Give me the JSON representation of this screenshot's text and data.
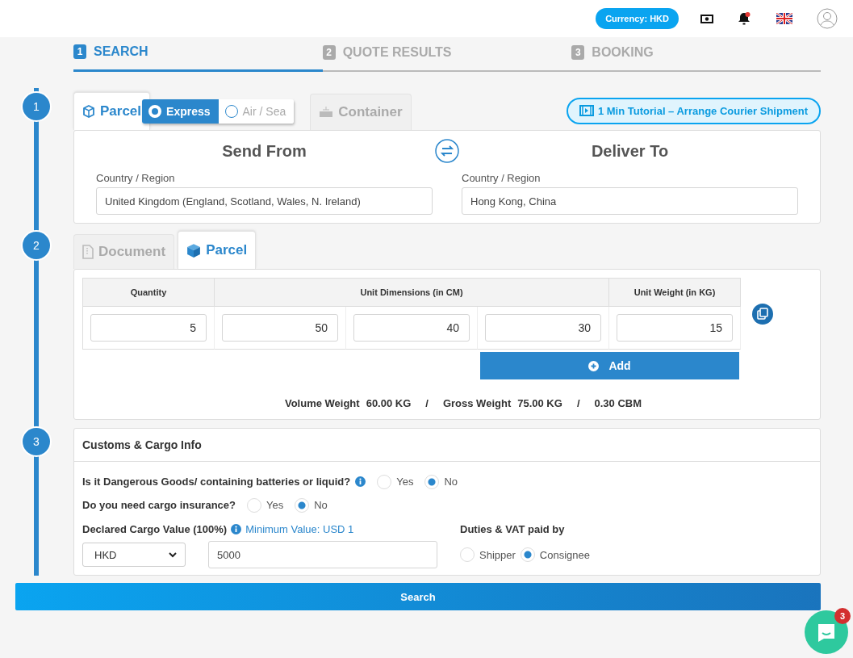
{
  "header": {
    "currency": "Currency: HKD"
  },
  "steps": [
    {
      "number": "1",
      "label": "SEARCH",
      "selected": true
    },
    {
      "number": "2",
      "label": "QUOTE RESULTS",
      "selected": false
    },
    {
      "number": "3",
      "label": "BOOKING",
      "selected": false
    }
  ],
  "section_numbers": [
    "1",
    "2",
    "3"
  ],
  "mode_tabs": [
    {
      "label": "Parcel",
      "selected": true,
      "kind": "parcel"
    },
    {
      "label": "Container",
      "selected": false,
      "kind": "container"
    }
  ],
  "service_options": [
    {
      "label": "Express",
      "selected": true
    },
    {
      "label": "Air / Sea",
      "selected": false
    }
  ],
  "tutorial_button": "1 Min Tutorial – Arrange Courier Shipment",
  "route": {
    "from_title": "Send From",
    "to_title": "Deliver To",
    "from_label": "Country / Region",
    "from_value": "United Kingdom (England, Scotland, Wales, N. Ireland)",
    "to_label": "Country / Region",
    "to_value": "Hong Kong, China"
  },
  "item_tabs": [
    {
      "label": "Document",
      "selected": false,
      "kind": "document"
    },
    {
      "label": "Parcel",
      "selected": true,
      "kind": "parcel"
    }
  ],
  "dimensions_table": {
    "columns": [
      "Quantity",
      "Unit Dimensions (in CM)",
      "Unit Weight (in KG)"
    ],
    "values": [
      "5",
      "50",
      "40",
      "30",
      "15"
    ]
  },
  "add_button": "Add",
  "totals": [
    {
      "kind": "pair",
      "label": "Volume Weight",
      "value": "60.00 KG"
    },
    {
      "kind": "separator",
      "text": "/"
    },
    {
      "kind": "pair",
      "label": "Gross Weight",
      "value": "75.00 KG"
    },
    {
      "kind": "separator",
      "text": "/"
    },
    {
      "kind": "plain",
      "text": "0.30 CBM"
    }
  ],
  "customs": {
    "title": "Customs & Cargo Info",
    "questions": [
      {
        "text": "Is it Dangerous Goods/ containing batteries or liquid?",
        "info": true,
        "options": [
          {
            "label": "Yes",
            "selected": false
          },
          {
            "label": "No",
            "selected": true
          }
        ]
      },
      {
        "text": "Do you need cargo insurance?",
        "info": false,
        "options": [
          {
            "label": "Yes",
            "selected": false
          },
          {
            "label": "No",
            "selected": true
          }
        ]
      }
    ],
    "declared": {
      "label": "Declared Cargo Value (100%)",
      "hint": "Minimum Value: USD 1",
      "currency": "HKD",
      "value": "5000"
    },
    "duties": {
      "label": "Duties & VAT paid by",
      "options": [
        {
          "label": "Shipper",
          "selected": false
        },
        {
          "label": "Consignee",
          "selected": true
        }
      ]
    }
  },
  "search_button": "Search",
  "chat": {
    "badge": "3"
  }
}
